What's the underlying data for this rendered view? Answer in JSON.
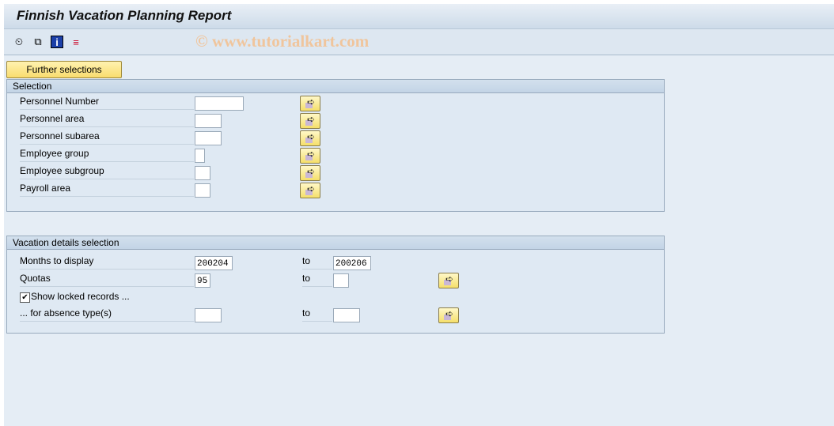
{
  "title": "Finnish Vacation Planning Report",
  "watermark": "© www.tutorialkart.com",
  "toolbar": [
    {
      "icon": "execute-clock-icon",
      "glyph": "⏲"
    },
    {
      "icon": "variant-icon",
      "glyph": "⧉"
    },
    {
      "icon": "info-icon",
      "glyph": "i"
    },
    {
      "icon": "selection-options-icon",
      "glyph": "≡"
    }
  ],
  "further_selections": "Further selections",
  "selection": {
    "header": "Selection",
    "rows": [
      {
        "label": "Personnel Number",
        "value": ""
      },
      {
        "label": "Personnel area",
        "value": ""
      },
      {
        "label": "Personnel subarea",
        "value": ""
      },
      {
        "label": "Employee group",
        "value": ""
      },
      {
        "label": "Employee subgroup",
        "value": ""
      },
      {
        "label": "Payroll area",
        "value": ""
      }
    ]
  },
  "vacation": {
    "header": "Vacation details selection",
    "months_label": "Months to display",
    "months_from": "200204",
    "months_to": "200206",
    "quotas_label": "Quotas",
    "quotas_from": "95",
    "quotas_to": "",
    "locked_label": "Show locked records ...",
    "locked_checked": true,
    "absence_label": "... for absence type(s)",
    "absence_from": "",
    "absence_to": "",
    "to_label": "to"
  }
}
